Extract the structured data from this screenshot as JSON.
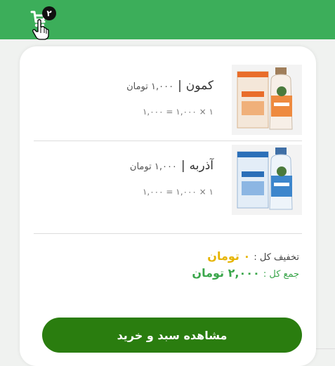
{
  "header": {
    "cart_count": "۲",
    "icons": {
      "cart": "cart-icon",
      "cursor": "hand-pointer-icon"
    },
    "colors": {
      "bar": "#3cae5a",
      "badge": "#111111"
    }
  },
  "cart": {
    "items": [
      {
        "name": "کمون",
        "separator": "|",
        "price": "۱,۰۰۰ تومان",
        "calc": "۱ × ۱,۰۰۰ = ۱,۰۰۰",
        "image": "kamoon-bottle-image"
      },
      {
        "name": "آذربه",
        "separator": "|",
        "price": "۱,۰۰۰ تومان",
        "calc": "۱ × ۱,۰۰۰ = ۱,۰۰۰",
        "image": "azarbeh-bottle-image"
      }
    ],
    "summary": {
      "discount_label": "تخفیف کل :",
      "discount_value": "۰ تومان",
      "total_label": "جمع کل :",
      "total_value": "۲,۰۰۰ تومان"
    },
    "view_button": "مشاهده سبد و خرید",
    "colors": {
      "discount": "#e6b400",
      "total": "#3aa64b",
      "button": "#2a7d0f"
    }
  }
}
